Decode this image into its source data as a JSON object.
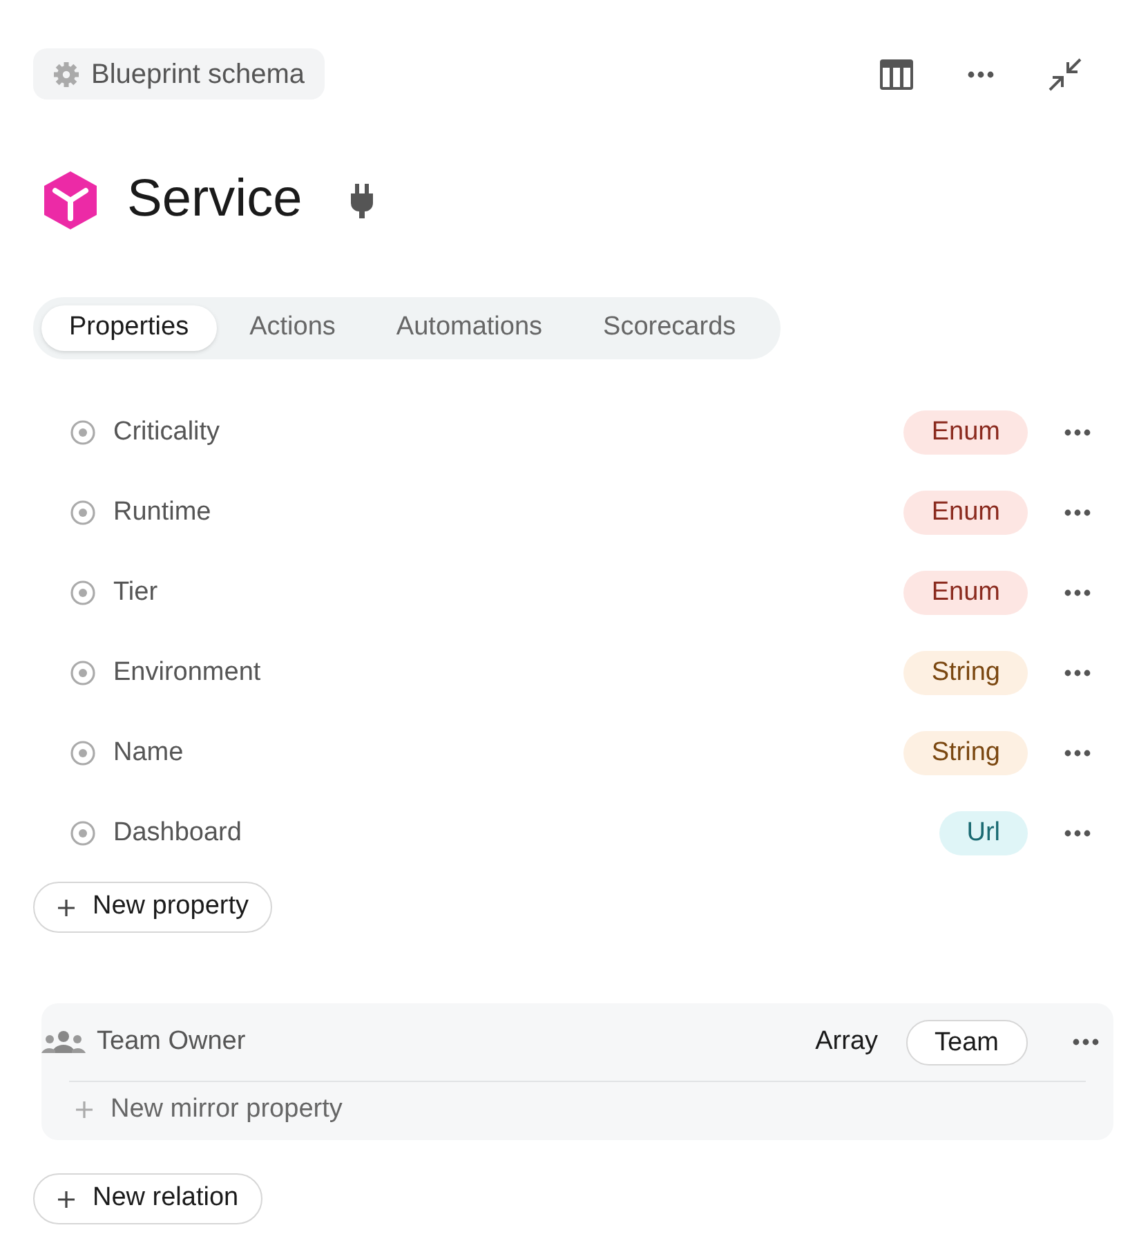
{
  "breadcrumb": {
    "label": "Blueprint schema"
  },
  "title": "Service",
  "tabs": [
    {
      "label": "Properties",
      "selected": true
    },
    {
      "label": "Actions",
      "selected": false
    },
    {
      "label": "Automations",
      "selected": false
    },
    {
      "label": "Scorecards",
      "selected": false
    }
  ],
  "properties": [
    {
      "name": "Criticality",
      "type": "Enum",
      "kind": "enum"
    },
    {
      "name": "Runtime",
      "type": "Enum",
      "kind": "enum"
    },
    {
      "name": "Tier",
      "type": "Enum",
      "kind": "enum"
    },
    {
      "name": "Environment",
      "type": "String",
      "kind": "string"
    },
    {
      "name": "Name",
      "type": "String",
      "kind": "string"
    },
    {
      "name": "Dashboard",
      "type": "Url",
      "kind": "url"
    }
  ],
  "new_property_button": "New property",
  "relations": [
    {
      "name": "Team Owner",
      "cardinality": "Array",
      "target": "Team",
      "new_mirror": "New mirror property"
    }
  ],
  "new_relation_button": "New relation"
}
